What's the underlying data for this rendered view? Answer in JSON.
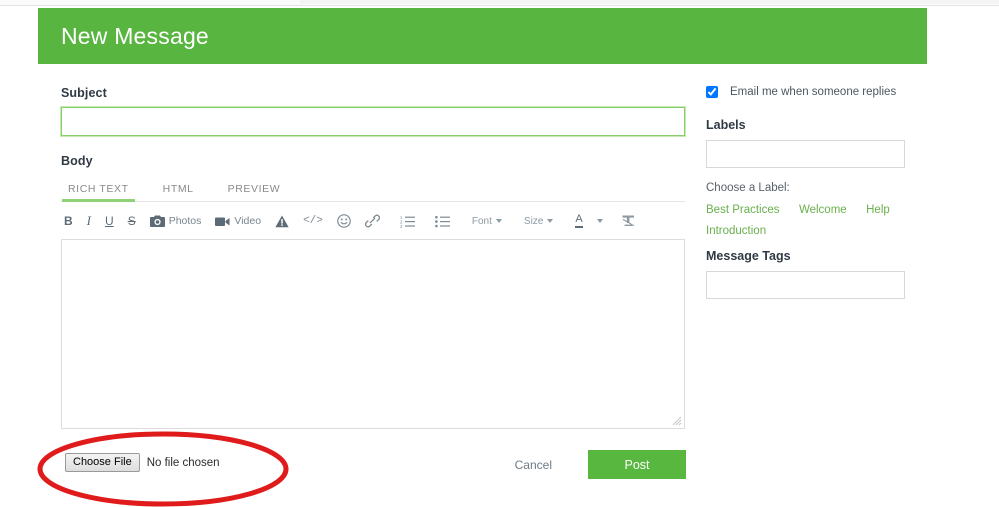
{
  "header": {
    "title": "New Message"
  },
  "form": {
    "subject_label": "Subject",
    "subject_value": "",
    "subject_placeholder": "",
    "body_label": "Body",
    "body_value": "",
    "body_placeholder": ""
  },
  "editor": {
    "tabs": [
      {
        "label": "RICH TEXT",
        "active": true
      },
      {
        "label": "HTML",
        "active": false
      },
      {
        "label": "PREVIEW",
        "active": false
      }
    ],
    "toolbar": [
      {
        "name": "bold-button",
        "glyph": "B",
        "label": ""
      },
      {
        "name": "italic-button",
        "glyph": "I",
        "label": ""
      },
      {
        "name": "underline-button",
        "glyph": "U",
        "label": ""
      },
      {
        "name": "strikethrough-button",
        "glyph": "S",
        "label": ""
      },
      {
        "name": "photos-button",
        "glyph": "camera-icon",
        "label": "Photos"
      },
      {
        "name": "video-button",
        "glyph": "video-camera-icon",
        "label": "Video"
      },
      {
        "name": "alert-button",
        "glyph": "warning-triangle-icon",
        "label": ""
      },
      {
        "name": "code-button",
        "glyph": "</>",
        "label": ""
      },
      {
        "name": "emoji-button",
        "glyph": "smiley-icon",
        "label": ""
      },
      {
        "name": "link-button",
        "glyph": "link-icon",
        "label": ""
      },
      {
        "name": "numbered-list-button",
        "glyph": "ordered-list-icon",
        "label": ""
      },
      {
        "name": "bullet-list-button",
        "glyph": "unordered-list-icon",
        "label": ""
      },
      {
        "name": "font-dropdown",
        "glyph": "caret",
        "label": "Font"
      },
      {
        "name": "size-dropdown",
        "glyph": "caret",
        "label": "Size"
      },
      {
        "name": "text-color-button",
        "glyph": "A",
        "label": ""
      },
      {
        "name": "clear-formatting-button",
        "glyph": "clear-format-icon",
        "label": ""
      }
    ]
  },
  "attachment": {
    "choose_file_label": "Choose File",
    "no_file_text": "No file chosen"
  },
  "actions": {
    "cancel_label": "Cancel",
    "post_label": "Post"
  },
  "sidebar": {
    "notify_label": "Email me when someone replies",
    "notify_checked": true,
    "labels_heading": "Labels",
    "labels_value": "",
    "labels_placeholder": "",
    "choose_label_text": "Choose a Label:",
    "label_options": [
      "Best Practices",
      "Welcome",
      "Help",
      "Introduction"
    ],
    "tags_heading": "Message Tags",
    "tags_value": "",
    "tags_placeholder": ""
  },
  "annotation": {
    "shape": "ellipse",
    "color": "#e01b1b",
    "target": "choose-file-control"
  },
  "colors": {
    "brand_green": "#58b540",
    "post_green": "#58b73f",
    "link_green": "#6ab04c",
    "annotation_red": "#e01b1b"
  }
}
